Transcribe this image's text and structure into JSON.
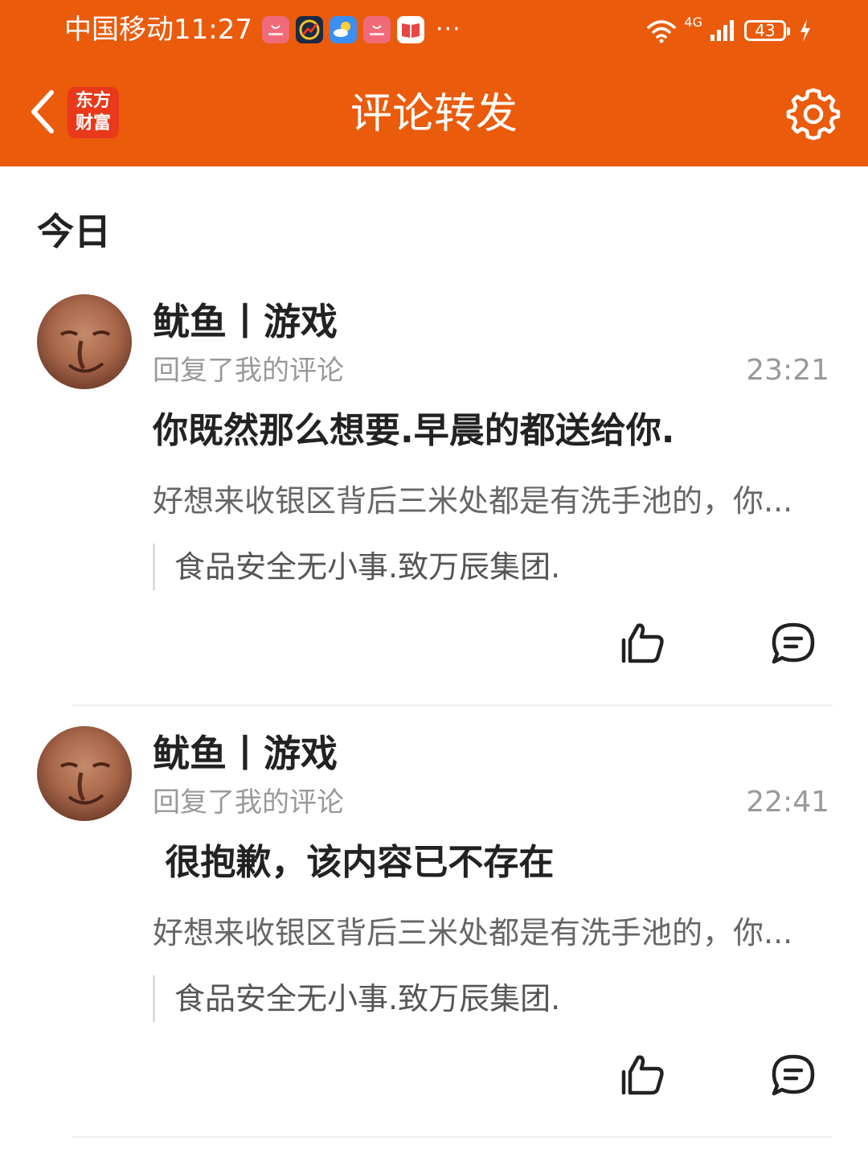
{
  "status_bar": {
    "carrier": "中国移动",
    "time": "11:27",
    "notification_icons": [
      "huawei-appgallery-icon",
      "stock-app-icon",
      "weather-icon",
      "huawei-appgallery-icon",
      "book-icon"
    ],
    "more": "···",
    "network": "4G",
    "battery": "43"
  },
  "nav": {
    "app_logo_line1": "东方",
    "app_logo_line2": "财富",
    "title": "评论转发",
    "back_icon": "chevron-left-icon",
    "settings_icon": "gear-icon"
  },
  "section": {
    "title": "今日"
  },
  "notifications": [
    {
      "username": "鱿鱼丨游戏",
      "action": "回复了我的评论",
      "time": "23:21",
      "reply": "你既然那么想要.早晨的都送给你.",
      "my_comment": "好想来收银区背后三米处都是有洗手池的，你...",
      "quote": "食品安全无小事.致万辰集团."
    },
    {
      "username": "鱿鱼丨游戏",
      "action": "回复了我的评论",
      "time": "22:41",
      "reply": " 很抱歉，该内容已不存在",
      "my_comment": "好想来收银区背后三米处都是有洗手池的，你...",
      "quote": "食品安全无小事.致万辰集团."
    }
  ],
  "colors": {
    "header_bg": "#ea5b0c",
    "logo_bg": "#e8391a",
    "text_primary": "#222222",
    "text_secondary": "#999999"
  }
}
